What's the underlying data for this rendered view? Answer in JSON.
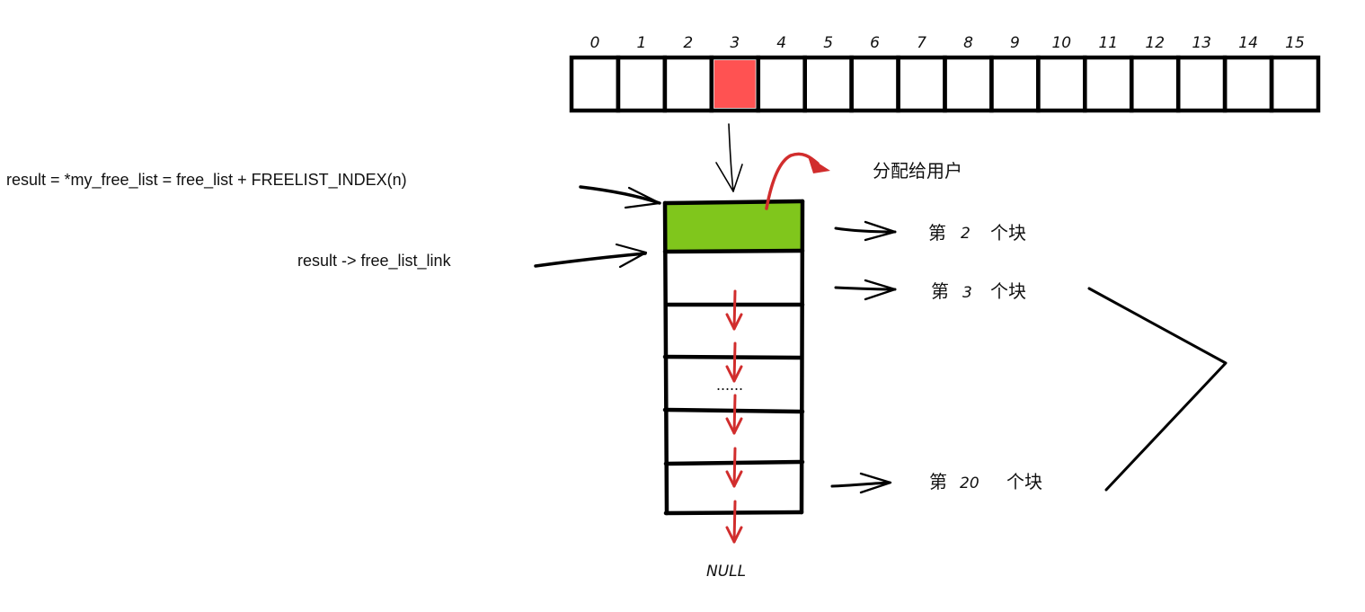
{
  "colors": {
    "ink": "#000000",
    "highlight_slot": "#ff5252",
    "allocated_block": "#80c61c",
    "arrow_red": "#d12d2d"
  },
  "array": {
    "indices": [
      "0",
      "1",
      "2",
      "3",
      "4",
      "5",
      "6",
      "7",
      "8",
      "9",
      "10",
      "11",
      "12",
      "13",
      "14",
      "15"
    ],
    "highlighted_index": 3
  },
  "labels": {
    "result_assign": "result = *my_free_list = free_list + FREELIST_INDEX(n)",
    "result_link": "result -> free_list_link",
    "allocate_to_user": "分配给用户",
    "ellipsis": "......",
    "null": "NULL"
  },
  "block_labels": {
    "second": {
      "prefix": "第",
      "num": "2",
      "suffix": "个块"
    },
    "third": {
      "prefix": "第",
      "num": "3",
      "suffix": "个块"
    },
    "twentieth": {
      "prefix": "第",
      "num": "20",
      "suffix": "个块"
    }
  }
}
